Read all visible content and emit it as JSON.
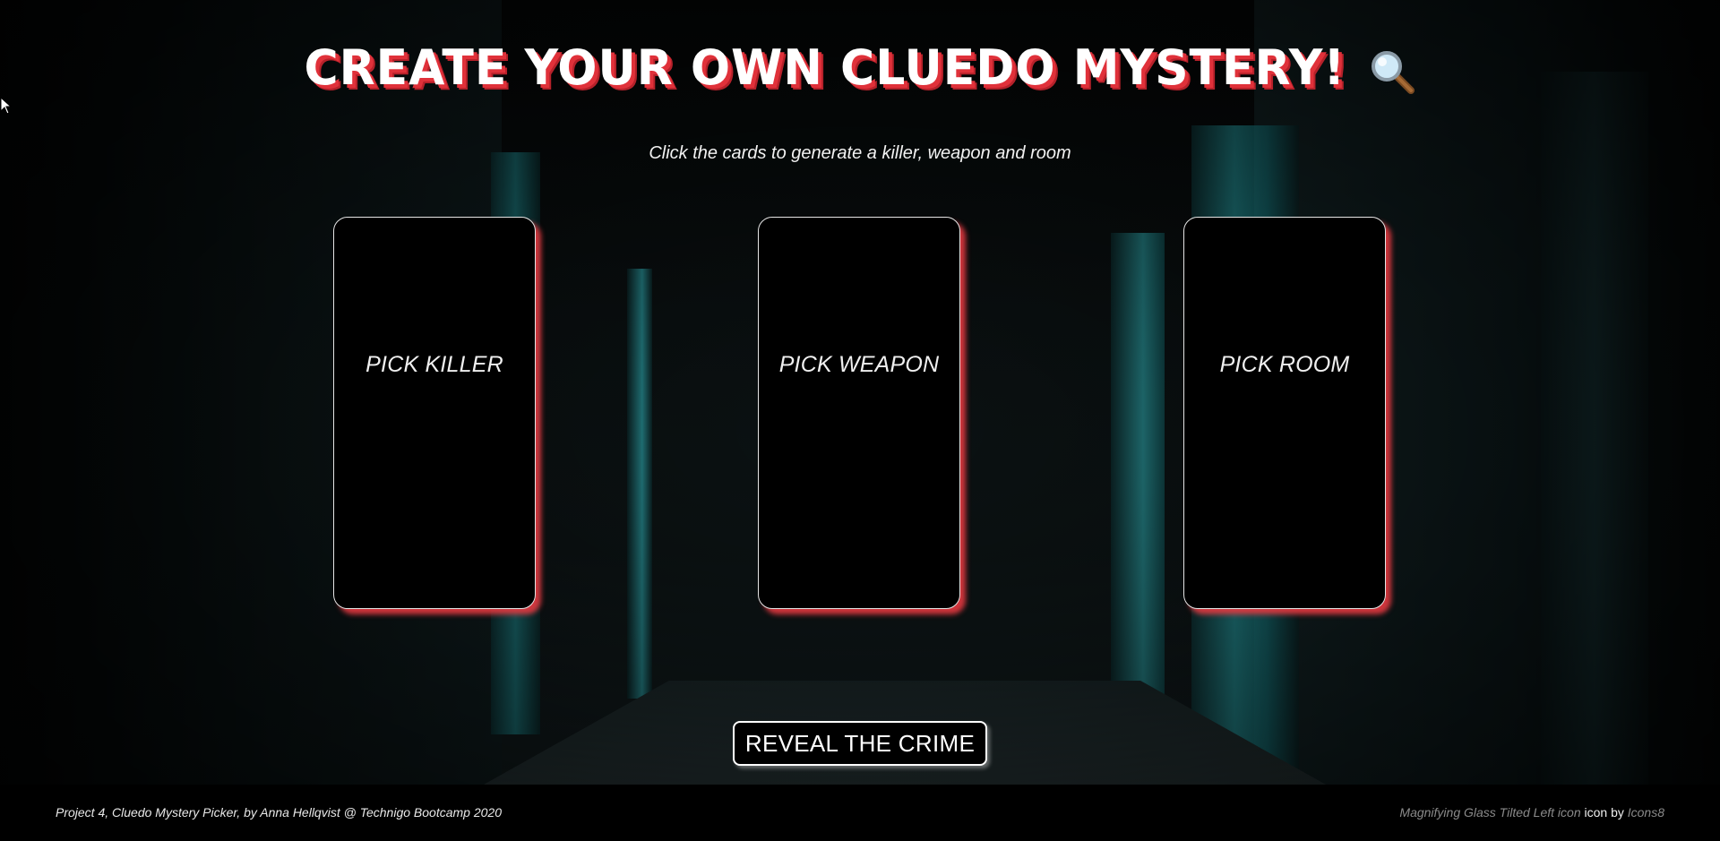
{
  "header": {
    "title": "CREATE YOUR OWN CLUEDO MYSTERY!",
    "title_icon": "magnifying-glass-icon",
    "subtitle": "Click the cards to generate a killer, weapon and room"
  },
  "cards": [
    {
      "label": "PICK KILLER"
    },
    {
      "label": "PICK WEAPON"
    },
    {
      "label": "PICK ROOM"
    }
  ],
  "reveal_button": {
    "label": "REVEAL THE CRIME"
  },
  "footer": {
    "credit": "Project 4, Cluedo Mystery Picker, by Anna Hellqvist @ Technigo Bootcamp 2020",
    "icon_link": "Magnifying Glass Tilted Left icon",
    "icon_text": "icon by",
    "icons8_link": "Icons8"
  },
  "colors": {
    "title_shadow": "#e0313a",
    "card_shadow": "#e43840",
    "card_border": "#e6e6e6",
    "background": "#000000"
  }
}
